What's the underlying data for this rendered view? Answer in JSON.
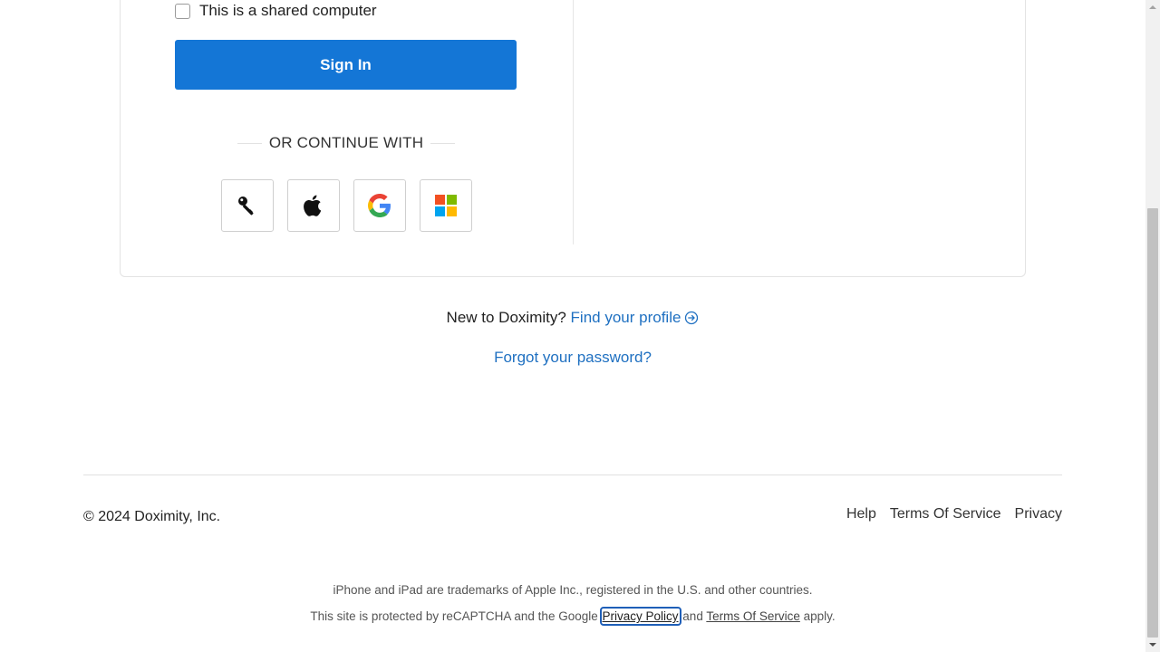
{
  "form": {
    "shared_label": "This is a shared computer",
    "signin_label": "Sign In",
    "or_text": "OR CONTINUE WITH"
  },
  "sso": [
    {
      "name": "passkey",
      "icon": "key-icon"
    },
    {
      "name": "apple",
      "icon": "apple-icon"
    },
    {
      "name": "google",
      "icon": "google-icon"
    },
    {
      "name": "microsoft",
      "icon": "microsoft-icon"
    }
  ],
  "signup": {
    "prompt": "New to Doximity?",
    "link": "Find your profile"
  },
  "forgot": "Forgot your password?",
  "footer": {
    "copyright": "© 2024 Doximity, Inc.",
    "links": [
      "Help",
      "Terms Of Service",
      "Privacy"
    ]
  },
  "legal": {
    "trademark": "iPhone and iPad are trademarks of Apple Inc., registered in the U.S. and other countries.",
    "recaptcha_prefix": "This site is protected by reCAPTCHA and the Google",
    "privacy_policy": "Privacy Policy",
    "and": "and",
    "terms": "Terms Of Service",
    "suffix": "apply."
  },
  "colors": {
    "primary": "#1476d6",
    "link": "#1f70c1"
  }
}
